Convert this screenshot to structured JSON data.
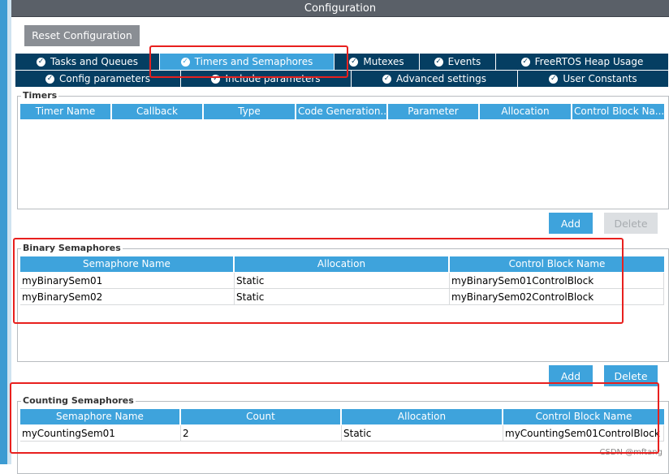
{
  "window": {
    "title": "Configuration"
  },
  "toolbar": {
    "reset_label": "Reset Configuration"
  },
  "tabs": {
    "row1": [
      {
        "label": "Tasks and Queues",
        "active": false
      },
      {
        "label": "Timers and Semaphores",
        "active": true
      },
      {
        "label": "Mutexes",
        "active": false
      },
      {
        "label": "Events",
        "active": false
      },
      {
        "label": "FreeRTOS Heap Usage",
        "active": false
      }
    ],
    "row2": [
      {
        "label": "Config parameters",
        "active": false
      },
      {
        "label": "Include parameters",
        "active": false
      },
      {
        "label": "Advanced settings",
        "active": false
      },
      {
        "label": "User Constants",
        "active": false
      }
    ]
  },
  "timers": {
    "legend": "Timers",
    "columns": [
      "Timer Name",
      "Callback",
      "Type",
      "Code Generation...",
      "Parameter",
      "Allocation",
      "Control Block Na..."
    ],
    "add_label": "Add",
    "delete_label": "Delete"
  },
  "binary": {
    "legend": "Binary Semaphores",
    "columns": [
      "Semaphore Name",
      "Allocation",
      "Control Block Name"
    ],
    "rows": [
      [
        "myBinarySem01",
        "Static",
        "myBinarySem01ControlBlock"
      ],
      [
        "myBinarySem02",
        "Static",
        "myBinarySem02ControlBlock"
      ]
    ],
    "add_label": "Add",
    "delete_label": "Delete"
  },
  "counting": {
    "legend": "Counting Semaphores",
    "columns": [
      "Semaphore Name",
      "Count",
      "Allocation",
      "Control Block Name"
    ],
    "rows": [
      [
        "myCountingSem01",
        "2",
        "Static",
        "myCountingSem01ControlBlock"
      ]
    ]
  },
  "watermark": "CSDN @mftang",
  "colors": {
    "tab_dark": "#053e62",
    "tab_active": "#3ea3dc",
    "header_blue": "#3ea3dc",
    "annotation_red": "#e8201e"
  }
}
